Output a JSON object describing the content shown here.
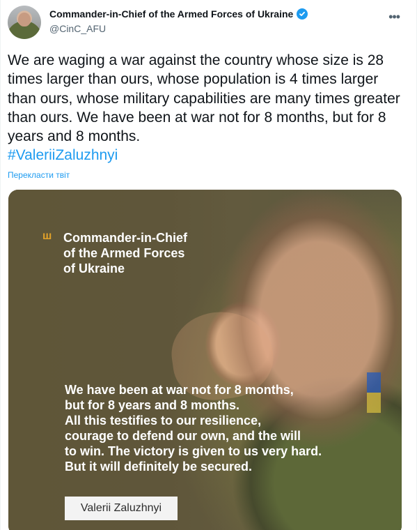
{
  "tweet": {
    "author": {
      "display_name": "Commander-in-Chief of the Armed Forces of Ukraine",
      "handle": "@CinC_AFU"
    },
    "more_icon": "more-horizontal-icon",
    "text": "We are waging a war against the country whose size is 28 times larger than ours, whose population is 4 times larger than ours, whose military capabilities are many times greater than ours. We have been at war not for 8 months, but for 8 years and 8 months.",
    "hashtag": "#ValeriiZaluzhnyi",
    "translate_label": "Перекласти твіт"
  },
  "media": {
    "title": "Commander-in-Chief\nof the Armed Forces\nof Ukraine",
    "quote": "We have been at war not for 8 months,\nbut for 8 years and 8 months.\nAll this testifies to our resilience,\ncourage to defend our own, and the will\nto win. The victory is given to us very hard.\nBut it will definitely be secured.",
    "signature": "Valerii Zaluzhnyi",
    "logo_icon": "trident-icon"
  },
  "colors": {
    "link": "#1d9bf0",
    "text": "#0f1419",
    "muted": "#536471",
    "accent": "#e1a129"
  }
}
